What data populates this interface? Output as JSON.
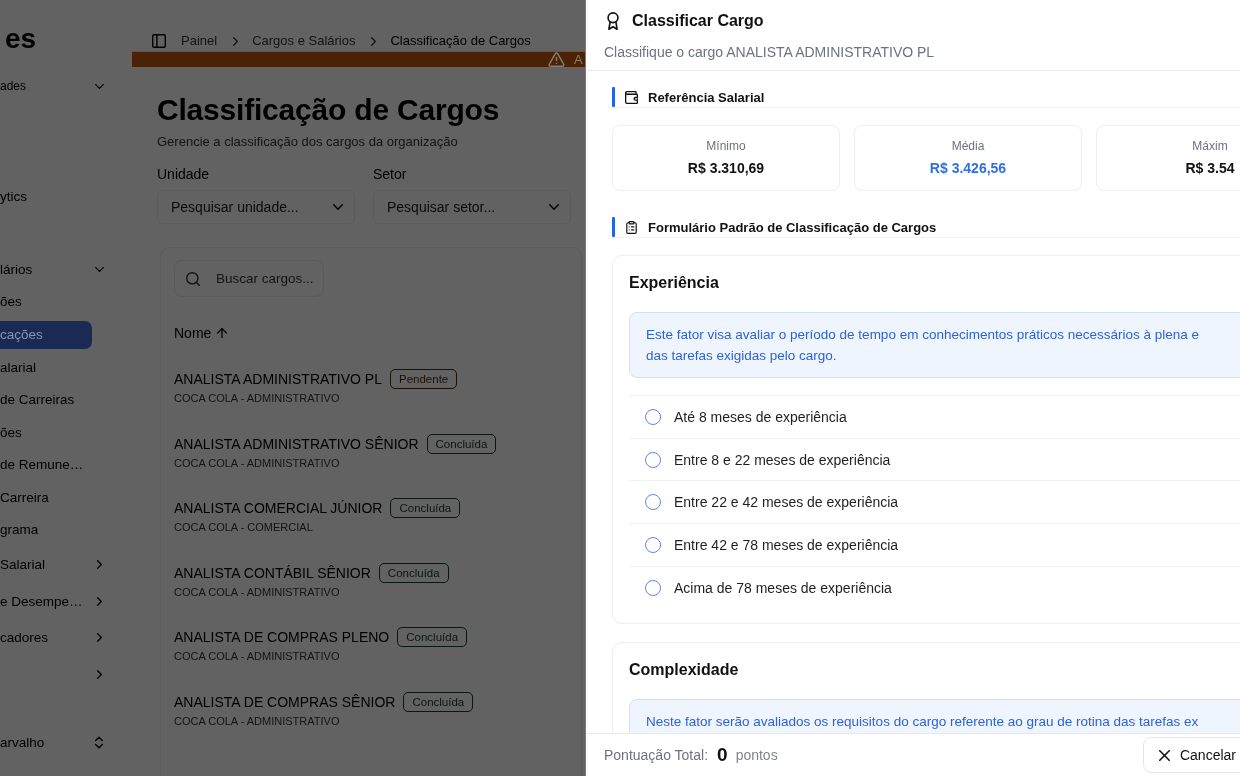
{
  "sidebar": {
    "logo": "es",
    "unit_selector": {
      "label": "ades"
    },
    "nav": [
      {
        "label": "ytics"
      },
      {
        "label": "lários",
        "expanded": true,
        "children": [
          {
            "label": "ões",
            "selected": false
          },
          {
            "label": "cações",
            "selected": true
          },
          {
            "label": "alarial",
            "selected": false
          },
          {
            "label": "de Carreiras",
            "selected": false
          },
          {
            "label": "ões",
            "selected": false
          },
          {
            "label": "de Remune…",
            "selected": false
          },
          {
            "label": "Carreira",
            "selected": false
          },
          {
            "label": "grama",
            "selected": false
          }
        ]
      },
      {
        "label": "Salarial",
        "expanded": false
      },
      {
        "label": "e Desempe…",
        "expanded": false
      },
      {
        "label": "cadores",
        "expanded": false
      },
      {
        "expanded": false
      }
    ],
    "user": {
      "name": "arvalho"
    }
  },
  "breadcrumb": [
    "Painel",
    "Cargos e Salários",
    "Classificação de Cargos"
  ],
  "banner": {
    "text": "A"
  },
  "page": {
    "title": "Classificação de Cargos",
    "subtitle": "Gerencie a classificação dos cargos da organização"
  },
  "filters": [
    {
      "label": "Unidade",
      "placeholder": "Pesquisar unidade..."
    },
    {
      "label": "Setor",
      "placeholder": "Pesquisar setor..."
    }
  ],
  "table": {
    "search": {
      "placeholder": "Buscar cargos..."
    },
    "columns": [
      {
        "label": "Nome",
        "ascending": true
      }
    ],
    "rows": [
      {
        "name": "ANALISTA ADMINISTRATIVO PL",
        "status": "Pendente",
        "color": "#1d1005",
        "detail": "COCA COLA - ADMINISTRATIVO"
      },
      {
        "name": "ANALISTA ADMINISTRATIVO SÊNIOR",
        "status": "Concluída",
        "color": "#0a1711",
        "detail": "COCA COLA - ADMINISTRATIVO"
      },
      {
        "name": "ANALISTA COMERCIAL JÚNIOR",
        "status": "Concluída",
        "color": "#0a1711",
        "detail": "COCA COLA - COMERCIAL"
      },
      {
        "name": "ANALISTA CONTÁBIL SÊNIOR",
        "status": "Concluída",
        "color": "#0a1711",
        "detail": "COCA COLA - ADMINISTRATIVO"
      },
      {
        "name": "ANALISTA DE COMPRAS PLENO",
        "status": "Concluída",
        "color": "#0a1711",
        "detail": "COCA COLA - ADMINISTRATIVO"
      },
      {
        "name": "ANALISTA DE COMPRAS SÊNIOR",
        "status": "Concluída",
        "color": "#0a1711",
        "detail": "COCA COLA - ADMINISTRATIVO"
      }
    ]
  },
  "drawer": {
    "title": "Classificar Cargo",
    "subtitle": "Classifique o cargo ANALISTA ADMINISTRATIVO PL",
    "salary_section": {
      "title": "Referência Salarial",
      "cards": [
        {
          "label": "Mínimo",
          "value": "R$ 3.310,69",
          "highlight": false
        },
        {
          "label": "Média",
          "value": "R$ 3.426,56",
          "highlight": true
        },
        {
          "label": "Máxim",
          "value": "R$ 3.54",
          "highlight": false
        }
      ]
    },
    "form_section": {
      "title": "Formulário Padrão de Classificação de Cargos"
    },
    "factors": [
      {
        "title": "Experiência",
        "description": [
          "Este fator visa avaliar o período de tempo em conhecimentos práticos necessários à plena e",
          "das tarefas exigidas pelo cargo."
        ],
        "options": [
          {
            "label": "Até 8 meses de experiência",
            "selected": false
          },
          {
            "label": "Entre 8 e 22 meses de experiência",
            "selected": false
          },
          {
            "label": "Entre 22 e 42 meses de experiência",
            "selected": false
          },
          {
            "label": "Entre 42 e 78 meses de experiência",
            "selected": false
          },
          {
            "label": "Acima de 78 meses de experiência",
            "selected": false
          }
        ]
      },
      {
        "title": "Complexidade",
        "description": [
          "Neste fator serão avaliados os requisitos do cargo referente ao grau de rotina das tarefas ex"
        ]
      }
    ],
    "footer": {
      "total_label": "Pontuação Total:",
      "total": "0",
      "unit": "pontos",
      "cancel": "Cancelar"
    }
  }
}
